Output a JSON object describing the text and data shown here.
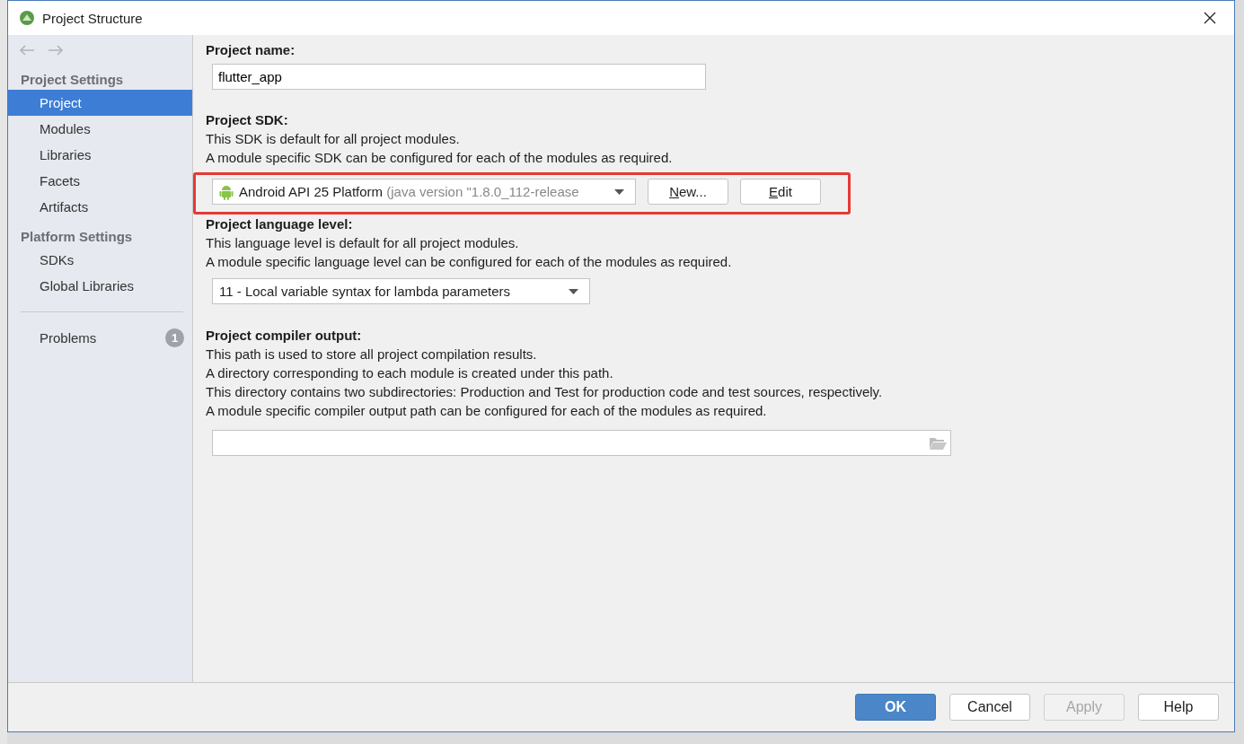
{
  "window": {
    "title": "Project Structure"
  },
  "sidebar": {
    "sections": [
      {
        "heading": "Project Settings",
        "items": [
          {
            "label": "Project",
            "selected": true
          },
          {
            "label": "Modules",
            "selected": false
          },
          {
            "label": "Libraries",
            "selected": false
          },
          {
            "label": "Facets",
            "selected": false
          },
          {
            "label": "Artifacts",
            "selected": false
          }
        ]
      },
      {
        "heading": "Platform Settings",
        "items": [
          {
            "label": "SDKs",
            "selected": false
          },
          {
            "label": "Global Libraries",
            "selected": false
          }
        ]
      }
    ],
    "problems": {
      "label": "Problems",
      "count": "1"
    }
  },
  "project_name": {
    "label": "Project name:",
    "value": "flutter_app"
  },
  "project_sdk": {
    "label": "Project SDK:",
    "lines": [
      "This SDK is default for all project modules.",
      "A module specific SDK can be configured for each of the modules as required."
    ],
    "selection": "Android API 25 Platform",
    "detail": "(java version \"1.8.0_112-release",
    "highlighted": true,
    "buttons": [
      "New...",
      "Edit"
    ]
  },
  "language_level": {
    "label": "Project language level:",
    "lines": [
      "This language level is default for all project modules.",
      "A module specific language level can be configured for each of the modules as required."
    ],
    "selection": "11 - Local variable syntax for lambda parameters"
  },
  "compiler_output": {
    "label": "Project compiler output:",
    "lines": [
      "This path is used to store all project compilation results.",
      "A directory corresponding to each module is created under this path.",
      "This directory contains two subdirectories: Production and Test for production code and test sources, respectively.",
      "A module specific compiler output path can be configured for each of the modules as required."
    ]
  },
  "buttons": [
    {
      "label": "OK",
      "kind": "primary",
      "disabled": false
    },
    {
      "label": "Cancel",
      "kind": "normal",
      "disabled": false
    },
    {
      "label": "Apply",
      "kind": "normal",
      "disabled": true
    },
    {
      "label": "Help",
      "kind": "normal",
      "disabled": false
    }
  ]
}
